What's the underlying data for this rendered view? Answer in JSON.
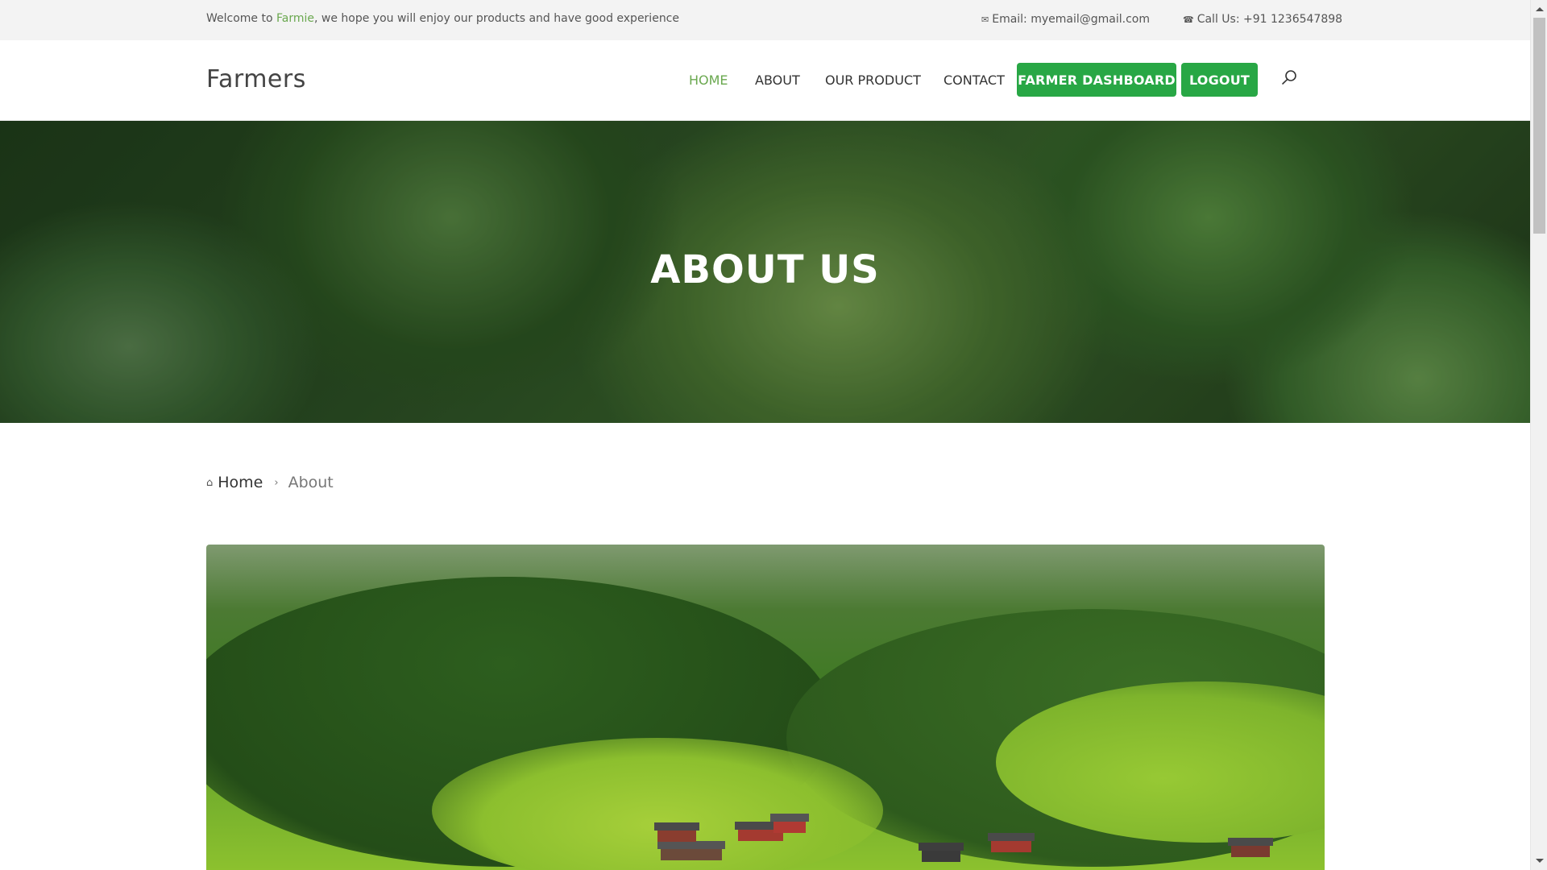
{
  "topbar": {
    "welcome_prefix": "Welcome to ",
    "welcome_brand": "Farmie",
    "welcome_suffix": ", we hope you will enjoy our products and have good experience",
    "email_icon": "envelope-icon",
    "email_text": "Email: myemail@gmail.com",
    "phone_icon": "phone-icon",
    "phone_text": "Call Us: +91 1236547898"
  },
  "header": {
    "logo": "Farmers",
    "nav": [
      {
        "label": "HOME",
        "active": true
      },
      {
        "label": "ABOUT",
        "active": false
      },
      {
        "label": "OUR PRODUCT",
        "active": false
      },
      {
        "label": "CONTACT",
        "active": false
      }
    ],
    "dashboard_button": "FARMER DASHBOARD",
    "logout_button": "LOGOUT",
    "search_icon": "search-icon"
  },
  "hero": {
    "title": "ABOUT US"
  },
  "breadcrumb": {
    "home_icon": "home-icon",
    "home": "Home",
    "separator_icon": "chevron-right-icon",
    "current": "About"
  },
  "colors": {
    "accent": "#6aa84f",
    "button": "#28a745",
    "topbar_bg": "#f3f3f3"
  }
}
